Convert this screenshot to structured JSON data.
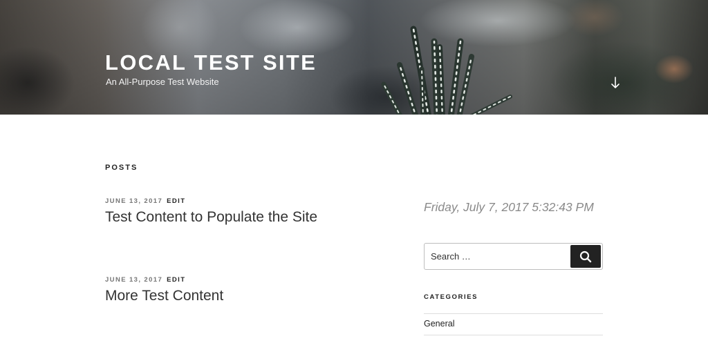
{
  "header": {
    "site_title": "LOCAL TEST SITE",
    "site_description": "An All-Purpose Test Website",
    "scroll_icon": "arrow-down-icon"
  },
  "main": {
    "section_heading": "POSTS",
    "posts": [
      {
        "date": "JUNE 13, 2017",
        "edit_label": "EDIT",
        "title": "Test Content to Populate the Site"
      },
      {
        "date": "JUNE 13, 2017",
        "edit_label": "EDIT",
        "title": "More Test Content"
      }
    ]
  },
  "sidebar": {
    "clock_text": "Friday, July 7, 2017 5:32:43 PM",
    "search": {
      "placeholder": "Search …",
      "button_icon": "search-icon"
    },
    "categories": {
      "title": "CATEGORIES",
      "items": [
        "General"
      ]
    }
  },
  "colors": {
    "search_button_bg": "#222222",
    "meta_gray": "#767676",
    "clock_gray": "#8a8a8a"
  }
}
